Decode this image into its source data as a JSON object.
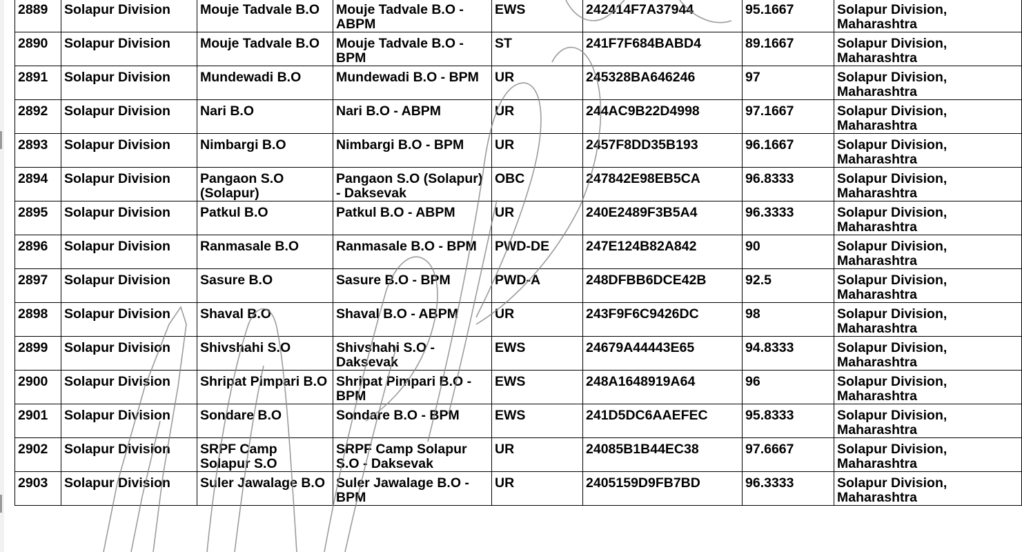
{
  "table": {
    "rows": [
      {
        "sno": "2889",
        "division": "Solapur Division",
        "office": "Mouje Tadvale B.O",
        "post": "Mouje Tadvale B.O - ABPM",
        "category": "EWS",
        "reg_no": "242414F7A37944",
        "marks": "95.1667",
        "circle": "Solapur Division, Maharashtra"
      },
      {
        "sno": "2890",
        "division": "Solapur Division",
        "office": "Mouje Tadvale B.O",
        "post": "Mouje Tadvale B.O - BPM",
        "category": "ST",
        "reg_no": "241F7F684BABD4",
        "marks": "89.1667",
        "circle": "Solapur Division, Maharashtra"
      },
      {
        "sno": "2891",
        "division": "Solapur Division",
        "office": "Mundewadi B.O",
        "post": "Mundewadi B.O - BPM",
        "category": "UR",
        "reg_no": "245328BA646246",
        "marks": "97",
        "circle": "Solapur Division, Maharashtra"
      },
      {
        "sno": "2892",
        "division": "Solapur Division",
        "office": "Nari B.O",
        "post": "Nari B.O - ABPM",
        "category": "UR",
        "reg_no": "244AC9B22D4998",
        "marks": "97.1667",
        "circle": "Solapur Division, Maharashtra"
      },
      {
        "sno": "2893",
        "division": "Solapur Division",
        "office": "Nimbargi B.O",
        "post": "Nimbargi B.O - BPM",
        "category": "UR",
        "reg_no": "2457F8DD35B193",
        "marks": "96.1667",
        "circle": "Solapur Division, Maharashtra"
      },
      {
        "sno": "2894",
        "division": "Solapur Division",
        "office": "Pangaon S.O (Solapur)",
        "post": "Pangaon S.O (Solapur) - Daksevak",
        "category": "OBC",
        "reg_no": "247842E98EB5CA",
        "marks": "96.8333",
        "circle": "Solapur Division, Maharashtra"
      },
      {
        "sno": "2895",
        "division": "Solapur Division",
        "office": "Patkul B.O",
        "post": "Patkul B.O - ABPM",
        "category": "UR",
        "reg_no": "240E2489F3B5A4",
        "marks": "96.3333",
        "circle": "Solapur Division, Maharashtra"
      },
      {
        "sno": "2896",
        "division": "Solapur Division",
        "office": "Ranmasale B.O",
        "post": "Ranmasale B.O - BPM",
        "category": "PWD-DE",
        "reg_no": "247E124B82A842",
        "marks": "90",
        "circle": "Solapur Division, Maharashtra"
      },
      {
        "sno": "2897",
        "division": "Solapur Division",
        "office": "Sasure B.O",
        "post": "Sasure B.O - BPM",
        "category": "PWD-A",
        "reg_no": "248DFBB6DCE42B",
        "marks": "92.5",
        "circle": "Solapur Division, Maharashtra"
      },
      {
        "sno": "2898",
        "division": "Solapur Division",
        "office": "Shaval B.O",
        "post": "Shaval B.O - ABPM",
        "category": "UR",
        "reg_no": "243F9F6C9426DC",
        "marks": "98",
        "circle": "Solapur Division, Maharashtra"
      },
      {
        "sno": "2899",
        "division": "Solapur Division",
        "office": "Shivshahi S.O",
        "post": "Shivshahi S.O - Daksevak",
        "category": "EWS",
        "reg_no": "24679A44443E65",
        "marks": "94.8333",
        "circle": "Solapur Division, Maharashtra"
      },
      {
        "sno": "2900",
        "division": "Solapur Division",
        "office": "Shripat Pimpari B.O",
        "post": "Shripat Pimpari B.O - BPM",
        "category": "EWS",
        "reg_no": "248A1648919A64",
        "marks": "96",
        "circle": "Solapur Division, Maharashtra"
      },
      {
        "sno": "2901",
        "division": "Solapur Division",
        "office": "Sondare B.O",
        "post": "Sondare B.O - BPM",
        "category": "EWS",
        "reg_no": "241D5DC6AAEFEC",
        "marks": "95.8333",
        "circle": "Solapur Division, Maharashtra"
      },
      {
        "sno": "2902",
        "division": "Solapur Division",
        "office": "SRPF Camp Solapur S.O",
        "post": "SRPF Camp Solapur S.O - Daksevak",
        "category": "UR",
        "reg_no": "24085B1B44EC38",
        "marks": "97.6667",
        "circle": "Solapur Division, Maharashtra"
      },
      {
        "sno": "2903",
        "division": "Solapur Division",
        "office": "Suler Jawalage B.O",
        "post": "Suler Jawalage B.O - BPM",
        "category": "UR",
        "reg_no": "2405159D9FB7BD",
        "marks": "96.3333",
        "circle": "Solapur Division, Maharashtra"
      }
    ]
  },
  "watermark": {
    "text": "IndiaPost",
    "color": "#8a8a8a"
  }
}
